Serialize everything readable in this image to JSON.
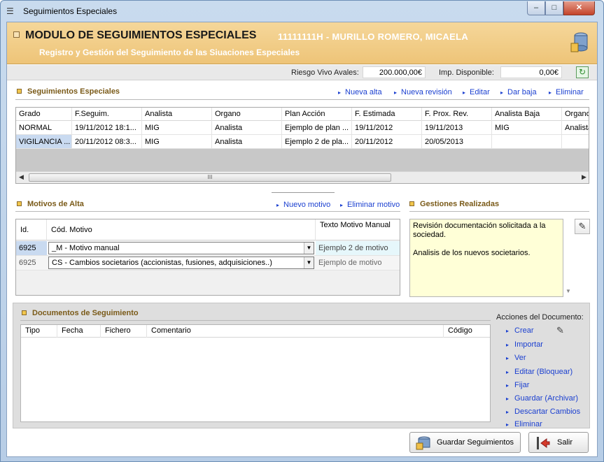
{
  "window": {
    "title": "Seguimientos Especiales",
    "controls": {
      "min": "–",
      "max": "□",
      "close": "✕"
    }
  },
  "header": {
    "title": "MODULO DE SEGUIMIENTOS ESPECIALES",
    "person": "11111111H - MURILLO ROMERO, MICAELA",
    "subtitle": "Registro y Gestión del Seguimiento de las Siuaciones Especiales",
    "icon": "database-icon"
  },
  "riesgo": {
    "label": "Riesgo Vivo Avales:",
    "value": "200.000,00€",
    "imp_label": "Imp. Disponible:",
    "imp_value": "0,00€",
    "refresh_icon": "refresh-icon"
  },
  "seguimientos": {
    "title": "Seguimientos Especiales",
    "actions": [
      "Nueva alta",
      "Nueva revisión",
      "Editar",
      "Dar baja",
      "Eliminar"
    ],
    "columns": [
      "Grado",
      "F.Seguim.",
      "Analista",
      "Organo",
      "Plan Acción",
      "F. Estimada",
      "F. Prox. Rev.",
      "Analista Baja",
      "Organo"
    ],
    "rows": [
      [
        "NORMAL",
        "19/11/2012 18:1...",
        "MIG",
        "Analista",
        "Ejemplo de plan ...",
        "19/11/2012",
        "19/11/2013",
        "MIG",
        "Analista"
      ],
      [
        "VIGILANCIA ...",
        "20/11/2012 08:3...",
        "MIG",
        "Analista",
        "Ejemplo 2 de pla...",
        "20/11/2012",
        "20/05/2013",
        "",
        ""
      ]
    ],
    "scroll_grip": "III"
  },
  "motivos": {
    "title": "Motivos de Alta",
    "actions": [
      "Nuevo motivo",
      "Eliminar motivo"
    ],
    "columns": [
      "Id.",
      "Cód. Motivo",
      "Texto Motivo Manual"
    ],
    "rows": [
      {
        "id": "6925",
        "motivo": "_M - Motivo manual",
        "texto": "Ejemplo 2 de motivo"
      },
      {
        "id": "6925",
        "motivo": "CS - Cambios societarios (accionistas, fusiones, adquisiciones..)",
        "texto": "Ejemplo de motivo"
      }
    ]
  },
  "gestiones": {
    "title": "Gestiones Realizadas",
    "text1": "Revisión documentación solicitada a la sociedad.",
    "text2": "Analisis de los nuevos societarios."
  },
  "documentos": {
    "title": "Documentos de Seguimiento",
    "columns": [
      "Tipo",
      "Fecha",
      "Fichero",
      "Comentario",
      "Código"
    ],
    "acciones_label": "Acciones del Documento:",
    "actions": [
      "Crear",
      "Importar",
      "Ver",
      "Editar (Bloquear)",
      "Fijar",
      "Guardar (Archivar)",
      "Descartar Cambios",
      "Eliminar"
    ]
  },
  "footer": {
    "save_label": "Guardar Seguimientos",
    "exit_label": "Salir"
  },
  "colors": {
    "header_bg": "#eec478",
    "link": "#1a3fd0",
    "selected_row": "#c9daf0",
    "gestiones_bg": "#ffffd7"
  }
}
